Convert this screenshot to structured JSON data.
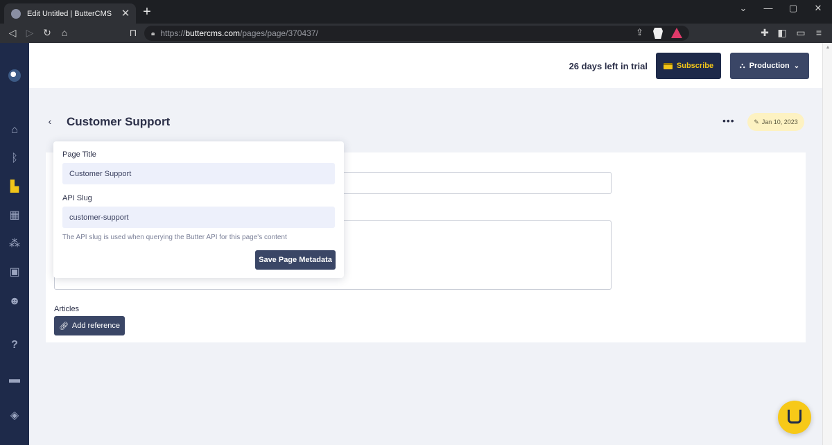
{
  "browser": {
    "tab_title": "Edit Untitled | ButterCMS",
    "tab_close": "✕",
    "new_tab": "+",
    "url_prefix": "https://",
    "url_domain": "buttercms.com",
    "url_path": "/pages/page/370437/"
  },
  "topbar": {
    "trial_text": "26 days left in trial",
    "subscribe_label": "Subscribe",
    "environment_label": "Production"
  },
  "page": {
    "title": "Customer Support",
    "date_badge": "Jan 10, 2023",
    "more": "•••",
    "back": "‹"
  },
  "metadata_popover": {
    "page_title_label": "Page Title",
    "page_title_value": "Customer Support",
    "api_slug_label": "API Slug",
    "api_slug_value": "customer-support",
    "help_text": "The API slug is used when querying the Butter API for this page's content",
    "save_label": "Save Page Metadata"
  },
  "content": {
    "articles_label": "Articles",
    "add_reference_label": "Add reference"
  },
  "colors": {
    "sidebar": "#1e2a4a",
    "accent_yellow": "#f0c419",
    "button_dark": "#3a4666",
    "page_bg": "#f0f2f7"
  }
}
